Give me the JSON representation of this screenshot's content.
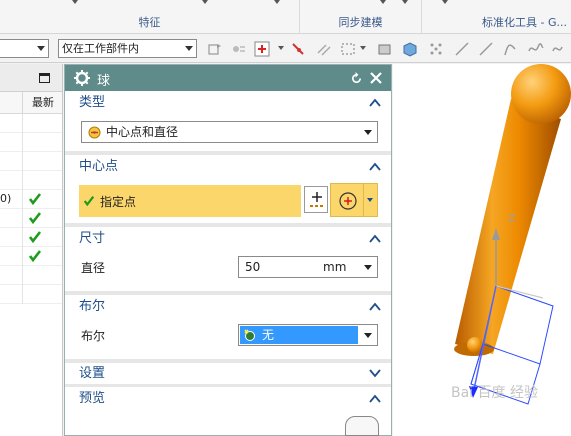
{
  "ribbon": {
    "groups": [
      {
        "label": "特征"
      },
      {
        "label": "同步建模"
      },
      {
        "label": "标准化工具 - G..."
      }
    ]
  },
  "toolbar": {
    "filter_select": "",
    "scope_select": "仅在工作部件内"
  },
  "part_navigator": {
    "column_latest": "最新",
    "partial_text": "0)",
    "checked_rows": 4
  },
  "dialog": {
    "title": "球",
    "sections": {
      "type": {
        "title": "类型",
        "value": "中心点和直径"
      },
      "center": {
        "title": "中心点",
        "specify_point": "指定点"
      },
      "dimensions": {
        "title": "尺寸",
        "diameter_label": "直径",
        "diameter_value": "50",
        "unit": "mm"
      },
      "boolean": {
        "title": "布尔",
        "label": "布尔",
        "value": "无"
      },
      "settings": {
        "title": "设置"
      },
      "preview": {
        "title": "预览"
      }
    }
  },
  "viewport": {
    "axis_label": "Z"
  },
  "watermark": "Bai 百度 经验",
  "colors": {
    "dialog_title_bg": "#5f8b8b",
    "section_title": "#1f4e8a",
    "highlight_yellow": "#fbd66b",
    "selected_blue": "#3399ff",
    "cylinder_orange": "#f08c00"
  }
}
